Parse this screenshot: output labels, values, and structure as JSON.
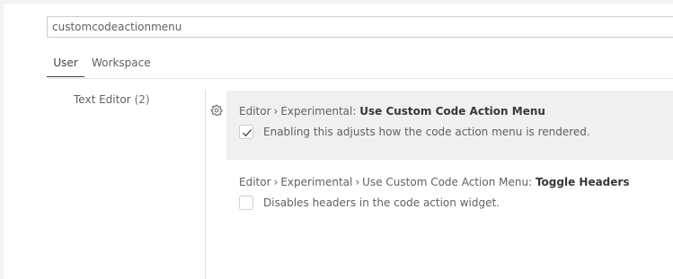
{
  "search": {
    "value": "customcodeactionmenu"
  },
  "tabs": [
    {
      "label": "User",
      "active": true
    },
    {
      "label": "Workspace",
      "active": false
    }
  ],
  "toc": {
    "items": [
      {
        "label": "Text Editor",
        "count": "(2)"
      }
    ]
  },
  "settings": [
    {
      "category": "Editor",
      "separator": "›",
      "subcategory": "Experimental:",
      "key": "Use Custom Code Action Menu",
      "description": "Enabling this adjusts how the code action menu is rendered.",
      "checked": true,
      "icon": "gear-icon"
    },
    {
      "category": "Editor",
      "separator": "›",
      "subcategory": "Experimental",
      "separator2": "›",
      "subcategory2": "Use Custom Code Action Menu:",
      "key": "Toggle Headers",
      "description": "Disables headers in the code action widget.",
      "checked": false
    }
  ],
  "colors": {
    "background": "#f3f3f3",
    "panel": "#ffffff",
    "focused_row": "#f0f0f0",
    "text": "#616161",
    "setting_key": "#383838",
    "active_tab_underline": "#424242"
  }
}
